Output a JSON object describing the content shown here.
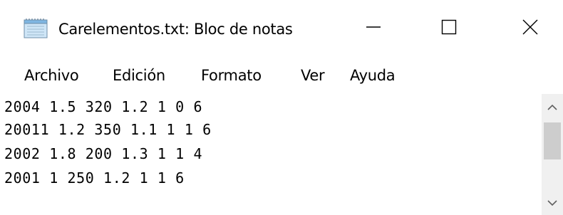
{
  "window": {
    "title": "Carelementos.txt: Bloc de notas",
    "icon": "notepad-icon"
  },
  "controls": {
    "minimize_icon": "minimize-icon",
    "maximize_icon": "maximize-icon",
    "close_icon": "close-icon"
  },
  "menu": {
    "items": [
      {
        "label": "Archivo"
      },
      {
        "label": "Edición"
      },
      {
        "label": "Formato"
      },
      {
        "label": "Ver"
      },
      {
        "label": "Ayuda"
      }
    ]
  },
  "editor": {
    "lines": [
      "2004 1.5 320 1.2 1 0 6",
      "20011 1.2 350 1.1 1 1 6",
      "2002 1.8 200 1.3 1 1 4",
      "2001 1 250 1.2 1 1 6"
    ]
  },
  "scrollbar": {
    "up_icon": "chevron-up-icon",
    "down_icon": "chevron-down-icon"
  }
}
